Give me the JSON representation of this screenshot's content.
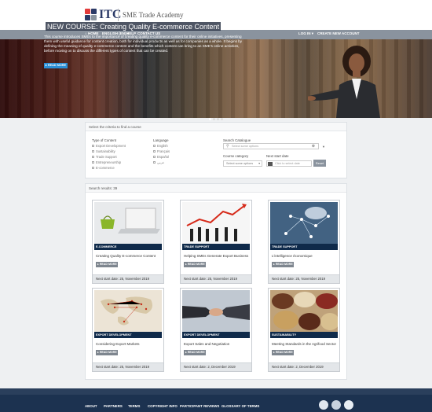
{
  "header": {
    "logo_text": "ITC",
    "subtitle": "SME Trade Academy"
  },
  "nav": {
    "home": "HOME",
    "language": "ENGLISH (EN)",
    "help": "HELP",
    "contact": "CONTACT US",
    "login": "LOG IN",
    "create_account": "CREATE NEW ACCOUNT"
  },
  "hero": {
    "title": "NEW COURSE: Creating Quality E-commerce Content",
    "description": "This course introduces SMEs to the importance of creating quality e-commerce content for their online initiatives, presenting them with useful guidance for content creation, both for individual products as well as for companies as a whole. It begins by defining the meaning of quality e-commerce content and the benefits which content can bring to an SME's online activities, before moving on to discuss the different types of content that can be created.",
    "button": "READ MORE"
  },
  "filters": {
    "heading": "Select the criteria to find a course",
    "type_title": "Type of Content",
    "types": [
      "Export Development",
      "Sustainability",
      "Trade Support",
      "Entrepreneurship",
      "E-commerce"
    ],
    "language_title": "Language",
    "languages": [
      "English",
      "Français",
      "Español",
      "عربي"
    ],
    "search_title": "Search Catalogue",
    "search_placeholder": "Select some options",
    "category_title": "Course category",
    "category_placeholder": "Select some options",
    "date_title": "Next start date",
    "date_placeholder": "Click to select date",
    "reset": "Reset"
  },
  "results": {
    "label": "Search results: 39"
  },
  "cards": [
    {
      "category": "E-COMMERCE",
      "title": "Creating Quality E-commerce Content",
      "button": "READ MORE",
      "date": "Next start date: 25, November 2019"
    },
    {
      "category": "TRADE SUPPORT",
      "title": "Helping SMEs Generate Export Business",
      "button": "READ MORE",
      "date": "Next start date: 25, November 2019"
    },
    {
      "category": "TRADE SUPPORT",
      "title": "L'intelligence économique",
      "button": "READ MORE",
      "date": "Next start date: 25, November 2019"
    },
    {
      "category": "EXPORT DEVELOPMENT",
      "title": "Considering Export Markets",
      "button": "READ MORE",
      "date": "Next start date: 25, November 2019"
    },
    {
      "category": "EXPORT DEVELOPMENT",
      "title": "Export Sales and Negotiation",
      "button": "READ MORE",
      "date": "Next start date: 2, December 2019"
    },
    {
      "category": "SUSTAINABILITY",
      "title": "Meeting Standards in the Agrifood Sector",
      "button": "READ MORE",
      "date": "Next start date: 2, December 2019"
    }
  ],
  "footer": {
    "links": [
      "ABOUT",
      "PARTNERS",
      "TERMS",
      "COPYRIGHT INFO",
      "PARTICIPANT REVIEWS",
      "GLOSSARY OF TERMS"
    ]
  },
  "colors": {
    "nav": "#8a939e",
    "accent": "#2b8fd6",
    "category_bar": "#0f2a4a",
    "footer": "#1c3250"
  }
}
